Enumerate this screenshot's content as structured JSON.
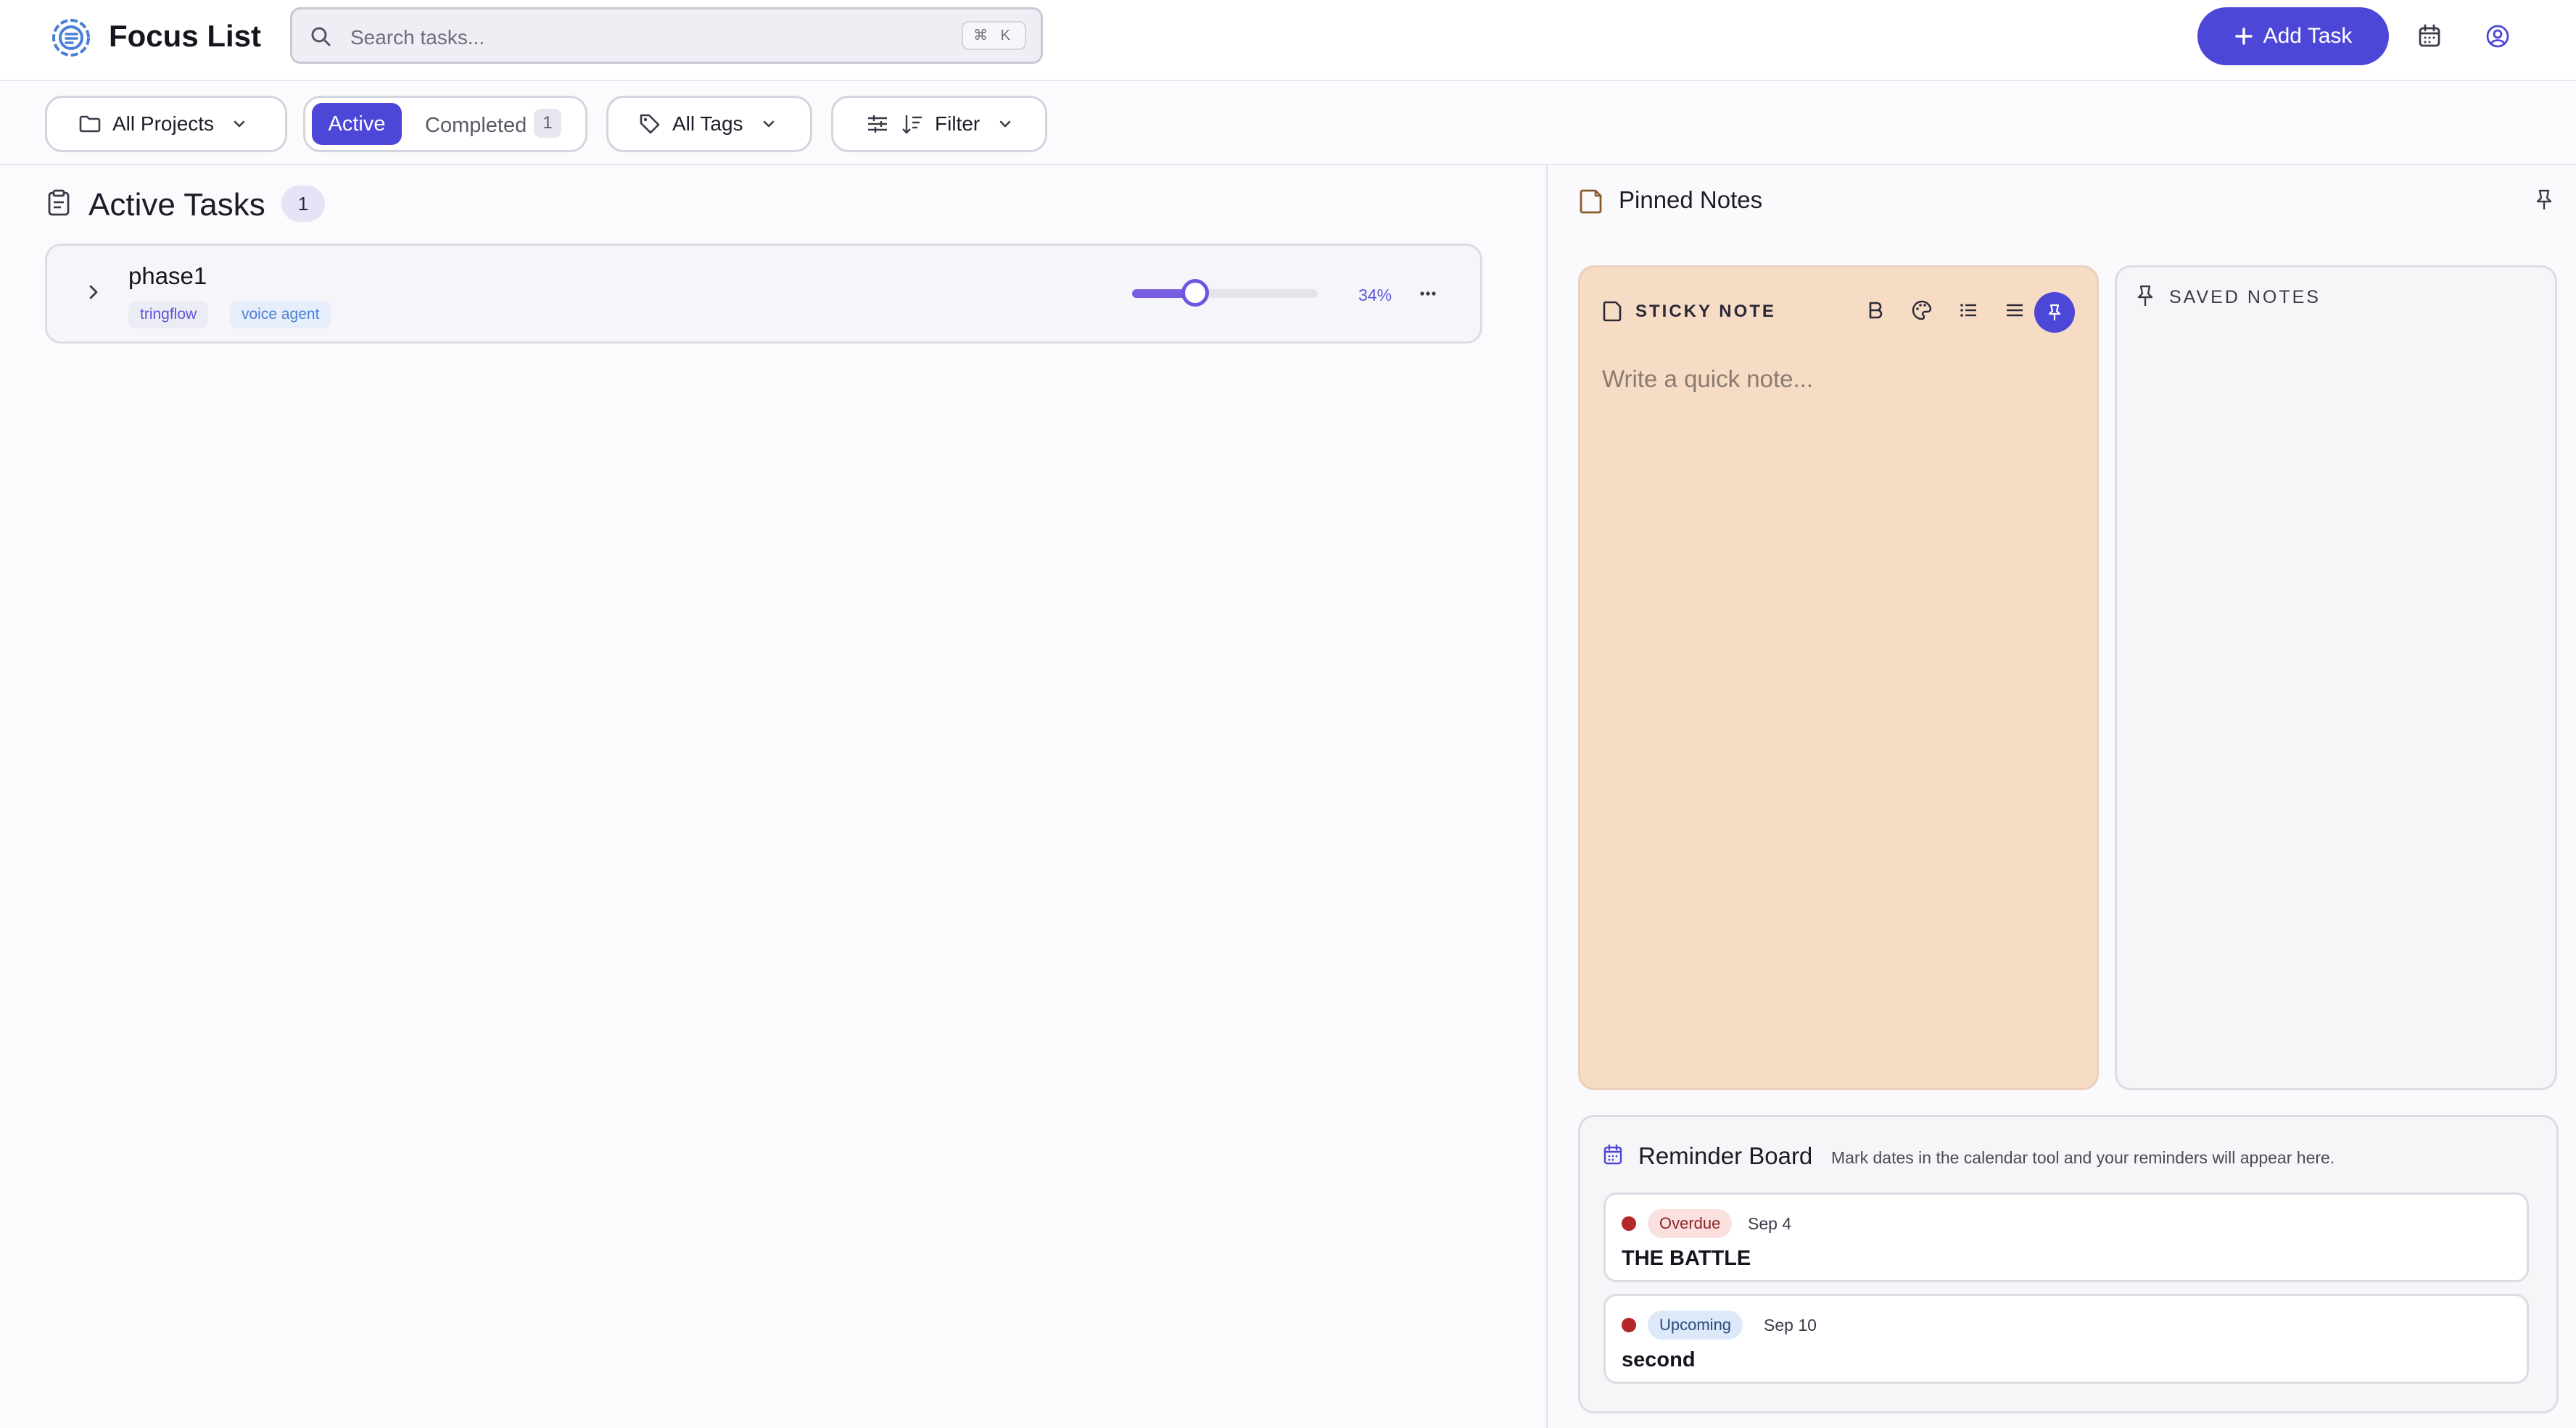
{
  "app": {
    "title": "Focus List"
  },
  "search": {
    "placeholder": "Search tasks...",
    "shortcut": "⌘ K"
  },
  "header": {
    "add_task_label": "Add Task"
  },
  "toolbar": {
    "projects_label": "All Projects",
    "active_label": "Active",
    "completed_label": "Completed",
    "completed_count": "1",
    "tags_label": "All Tags",
    "filter_label": "Filter"
  },
  "main": {
    "section_title": "Active Tasks",
    "section_count": "1",
    "tasks": [
      {
        "name": "phase1",
        "tags": [
          "tringflow",
          "voice agent"
        ],
        "progress_label": "34%",
        "progress": 0.34
      }
    ]
  },
  "notes_panel": {
    "title": "Pinned Notes",
    "sticky_label": "STICKY NOTE",
    "sticky_placeholder": "Write a quick note...",
    "saved_label": "SAVED NOTES"
  },
  "reminders": {
    "title": "Reminder Board",
    "subtitle": "Mark dates in the calendar tool and your reminders will appear here.",
    "items": [
      {
        "status": "Overdue",
        "date": "Sep 4",
        "title": "THE BATTLE"
      },
      {
        "status": "Upcoming",
        "date": "Sep 10",
        "title": "second"
      }
    ]
  },
  "colors": {
    "accent": "#4d47d8",
    "sticky_bg": "#f7dcc5",
    "overdue_dot": "#b3262a"
  },
  "icons": [
    "logo-icon",
    "search-icon",
    "plus-icon",
    "calendar-icon",
    "user-icon",
    "folder-icon",
    "tag-icon",
    "filter-icon",
    "clipboard-icon",
    "chevron-right-icon",
    "more-icon",
    "note-icon",
    "pin-icon",
    "bold-icon",
    "palette-icon",
    "list-icon",
    "align-icon"
  ]
}
